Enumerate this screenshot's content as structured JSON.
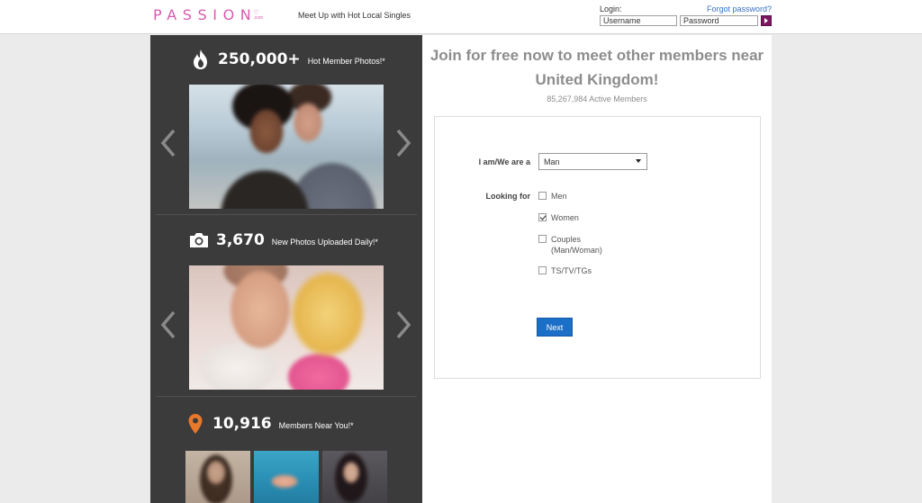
{
  "header": {
    "logo_text": "PASSION",
    "logo_domain": ".com",
    "tagline": "Meet Up with Hot Local Singles",
    "login_label": "Login:",
    "forgot_password": "Forgot password?",
    "username_placeholder": "Username",
    "password_placeholder": "Password",
    "brand_color": "#d65cae",
    "login_button_color": "#7a1760"
  },
  "left_panel": {
    "background": "#3c3b3c",
    "stats": [
      {
        "icon": "flame-icon",
        "number": "250,000+",
        "caption": "Hot Member Photos!*"
      },
      {
        "icon": "camera-icon",
        "number": "3,670",
        "caption": "New Photos Uploaded Daily!*"
      },
      {
        "icon": "location-pin-icon",
        "number": "10,916",
        "caption": "Members Near You!*"
      }
    ]
  },
  "main": {
    "headline": "Join for free now to meet other members near United Kingdom!",
    "active_members": "85,267,984 Active Members",
    "form": {
      "iam_label": "I am/We are a",
      "iam_value": "Man",
      "looking_for_label": "Looking for",
      "options": [
        {
          "label": "Men",
          "checked": false
        },
        {
          "label": "Women",
          "checked": true
        },
        {
          "label": "Couples (Man/Woman)",
          "line1": "Couples",
          "line2": "(Man/Woman)",
          "checked": false
        },
        {
          "label": "TS/TV/TGs",
          "checked": false
        }
      ],
      "next_label": "Next",
      "next_color": "#1b6fc6"
    }
  }
}
